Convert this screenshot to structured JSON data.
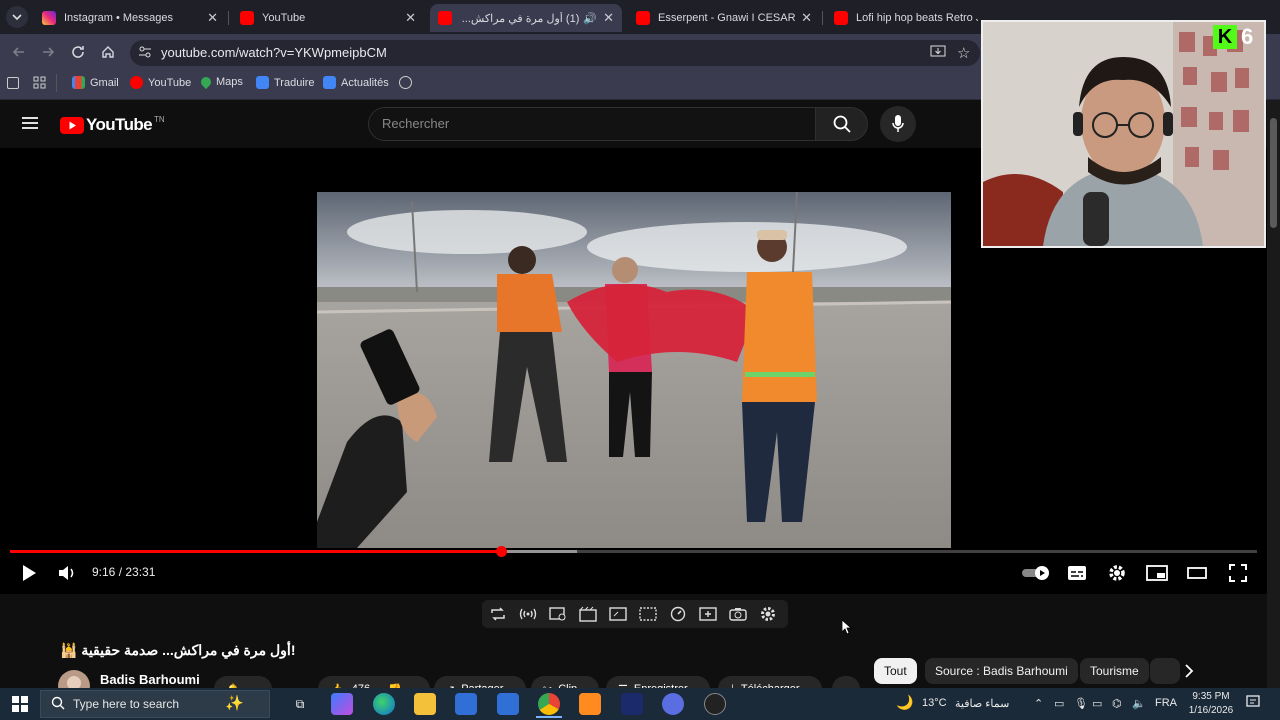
{
  "browser": {
    "tabs": [
      {
        "title": "Instagram • Messages",
        "favicon": "instagram-icon",
        "color": "#e1306c"
      },
      {
        "title": "YouTube",
        "favicon": "youtube-icon",
        "color": "#ff0000"
      },
      {
        "title": "(1) أول مرة في مراكش...",
        "favicon": "youtube-icon",
        "color": "#ff0000",
        "active": true
      },
      {
        "title": "Esserpent - Gnawi I CESAR ART",
        "favicon": "youtube-icon",
        "color": "#ff0000"
      },
      {
        "title": "Lofi hip hop beats Retro Japa",
        "favicon": "youtube-icon",
        "color": "#ff0000"
      }
    ],
    "url": "youtube.com/watch?v=YKWpmeipbCM",
    "bookmarks": [
      {
        "label": "Gmail",
        "icon": "gmail-icon"
      },
      {
        "label": "YouTube",
        "icon": "youtube-icon"
      },
      {
        "label": "Maps",
        "icon": "maps-icon"
      },
      {
        "label": "Traduire",
        "icon": "translate-icon"
      },
      {
        "label": "Actualités",
        "icon": "news-icon"
      }
    ]
  },
  "youtube": {
    "logo_text": "YouTube",
    "country_code": "TN",
    "search_placeholder": "Rechercher"
  },
  "player": {
    "current_time": "9:16",
    "duration": "23:31",
    "time_display": "9:16 / 23:31",
    "progress": 0.394,
    "buffered": 0.455
  },
  "webcam": {
    "badge_letter": "K",
    "badge_number": "6"
  },
  "video": {
    "title": "!أول مرة في مراكش... صدمة حقيقية 🕌",
    "channel": "Badis Barhoumi",
    "likes": "476",
    "actions": [
      "Partager",
      "Clip",
      "Enregistrer",
      "Télécharger"
    ]
  },
  "chips": [
    {
      "label": "Tout",
      "selected": true
    },
    {
      "label": "Source : Badis Barhoumi"
    },
    {
      "label": "Tourisme"
    }
  ],
  "taskbar": {
    "search_placeholder": "Type here to search",
    "weather": "13°C",
    "weather_desc": "سماء صافية",
    "language": "FRA",
    "time": "9:35 PM",
    "date": "1/16/2026"
  }
}
